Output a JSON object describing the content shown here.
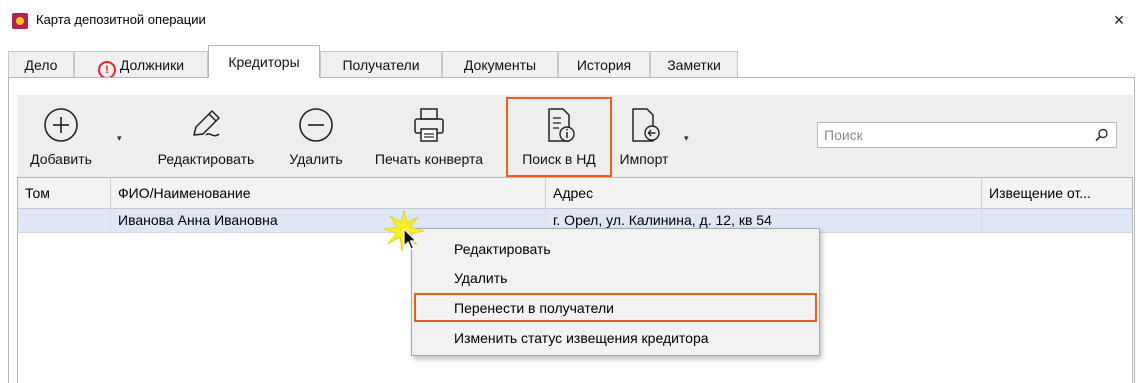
{
  "window": {
    "title": "Карта депозитной операции",
    "close": "×"
  },
  "tabs": [
    {
      "label": "Дело"
    },
    {
      "label": "Должники",
      "warning": "!"
    },
    {
      "label": "Кредиторы"
    },
    {
      "label": "Получатели"
    },
    {
      "label": "Документы"
    },
    {
      "label": "История"
    },
    {
      "label": "Заметки"
    }
  ],
  "active_tab": "Кредиторы",
  "toolbar": {
    "add": "Добавить",
    "edit": "Редактировать",
    "delete": "Удалить",
    "print": "Печать конверта",
    "search_nd": "Поиск в НД",
    "import": "Импорт"
  },
  "search": {
    "placeholder": "Поиск",
    "value": ""
  },
  "table": {
    "columns": [
      "Том",
      "ФИО/Наименование",
      "Адрес",
      "Извещение от..."
    ],
    "rows": [
      [
        "",
        "Иванова Анна Ивановна",
        "г. Орел, ул. Калинина, д. 12, кв 54",
        ""
      ]
    ]
  },
  "context_menu": {
    "items": [
      {
        "label": "Редактировать"
      },
      {
        "label": "Удалить"
      },
      {
        "label": "Перенести в получатели",
        "highlighted": true
      },
      {
        "label": "Изменить статус извещения кредитора"
      }
    ]
  },
  "colors": {
    "highlight": "#e86020",
    "selected_row": "#dde7f5",
    "warning": "#e0282e",
    "toolbar_bg": "#eeeeee"
  }
}
